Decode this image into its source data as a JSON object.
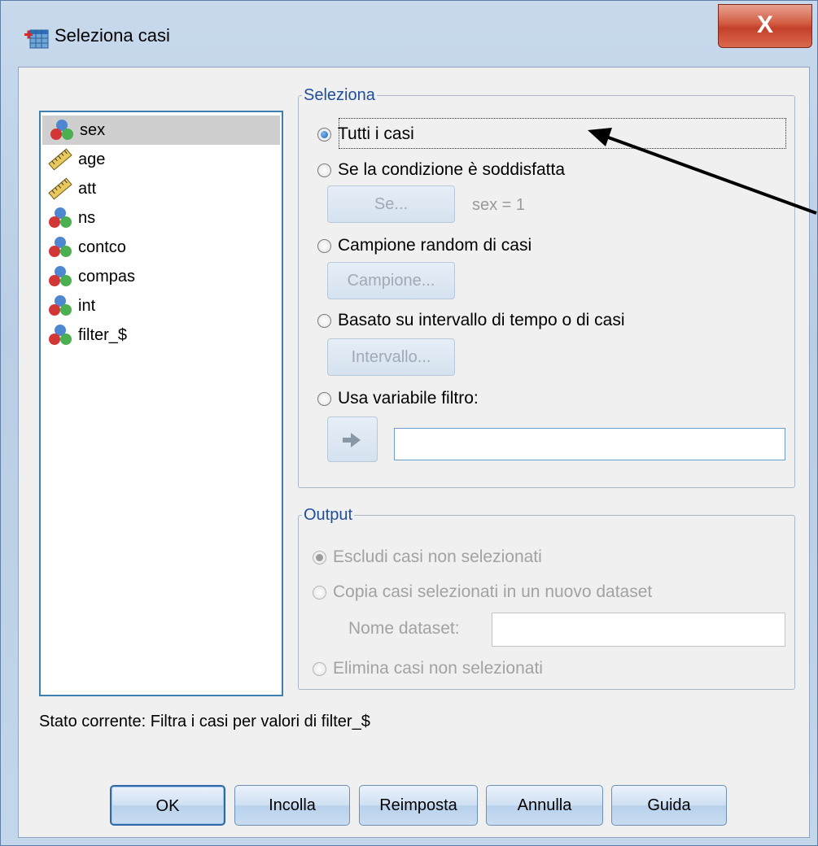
{
  "window": {
    "title": "Seleziona casi",
    "close_label": "X"
  },
  "variables": {
    "items": [
      {
        "label": "sex",
        "icon": "nominal-variable-icon",
        "selected": true
      },
      {
        "label": "age",
        "icon": "scale-variable-icon",
        "selected": false
      },
      {
        "label": "att",
        "icon": "scale-variable-icon",
        "selected": false
      },
      {
        "label": "ns",
        "icon": "nominal-variable-icon",
        "selected": false
      },
      {
        "label": "contco",
        "icon": "nominal-variable-icon",
        "selected": false
      },
      {
        "label": "compas",
        "icon": "nominal-variable-icon",
        "selected": false
      },
      {
        "label": "int",
        "icon": "nominal-variable-icon",
        "selected": false
      },
      {
        "label": "filter_$",
        "icon": "nominal-variable-icon",
        "selected": false
      }
    ]
  },
  "select_group": {
    "legend": "Seleziona",
    "options": {
      "all_cases": "Tutti i casi",
      "if_condition": "Se la condizione è soddisfatta",
      "random_sample": "Campione random di casi",
      "time_range": "Basato su intervallo di tempo o di casi",
      "filter_var": "Usa variabile filtro:"
    },
    "selected_option": "all_cases",
    "if_button": "Se...",
    "condition_text": "sex = 1",
    "sample_button": "Campione...",
    "range_button": "Intervallo...",
    "move_icon": "arrow-right-icon",
    "filter_value": ""
  },
  "output_group": {
    "legend": "Output",
    "options": {
      "exclude": "Escludi casi non selezionati",
      "copy": "Copia casi selezionati in un nuovo dataset",
      "delete": "Elimina casi non selezionati"
    },
    "selected_option": "exclude",
    "dataset_label": "Nome dataset:",
    "dataset_value": ""
  },
  "status": "Stato corrente: Filtra i casi per valori di filter_$",
  "buttons": {
    "ok": "OK",
    "paste": "Incolla",
    "reset": "Reimposta",
    "cancel": "Annulla",
    "help": "Guida"
  },
  "colors": {
    "legend": "#1f4e9a",
    "list_border": "#3c7fb1",
    "annotation_arrow": "#000000"
  }
}
